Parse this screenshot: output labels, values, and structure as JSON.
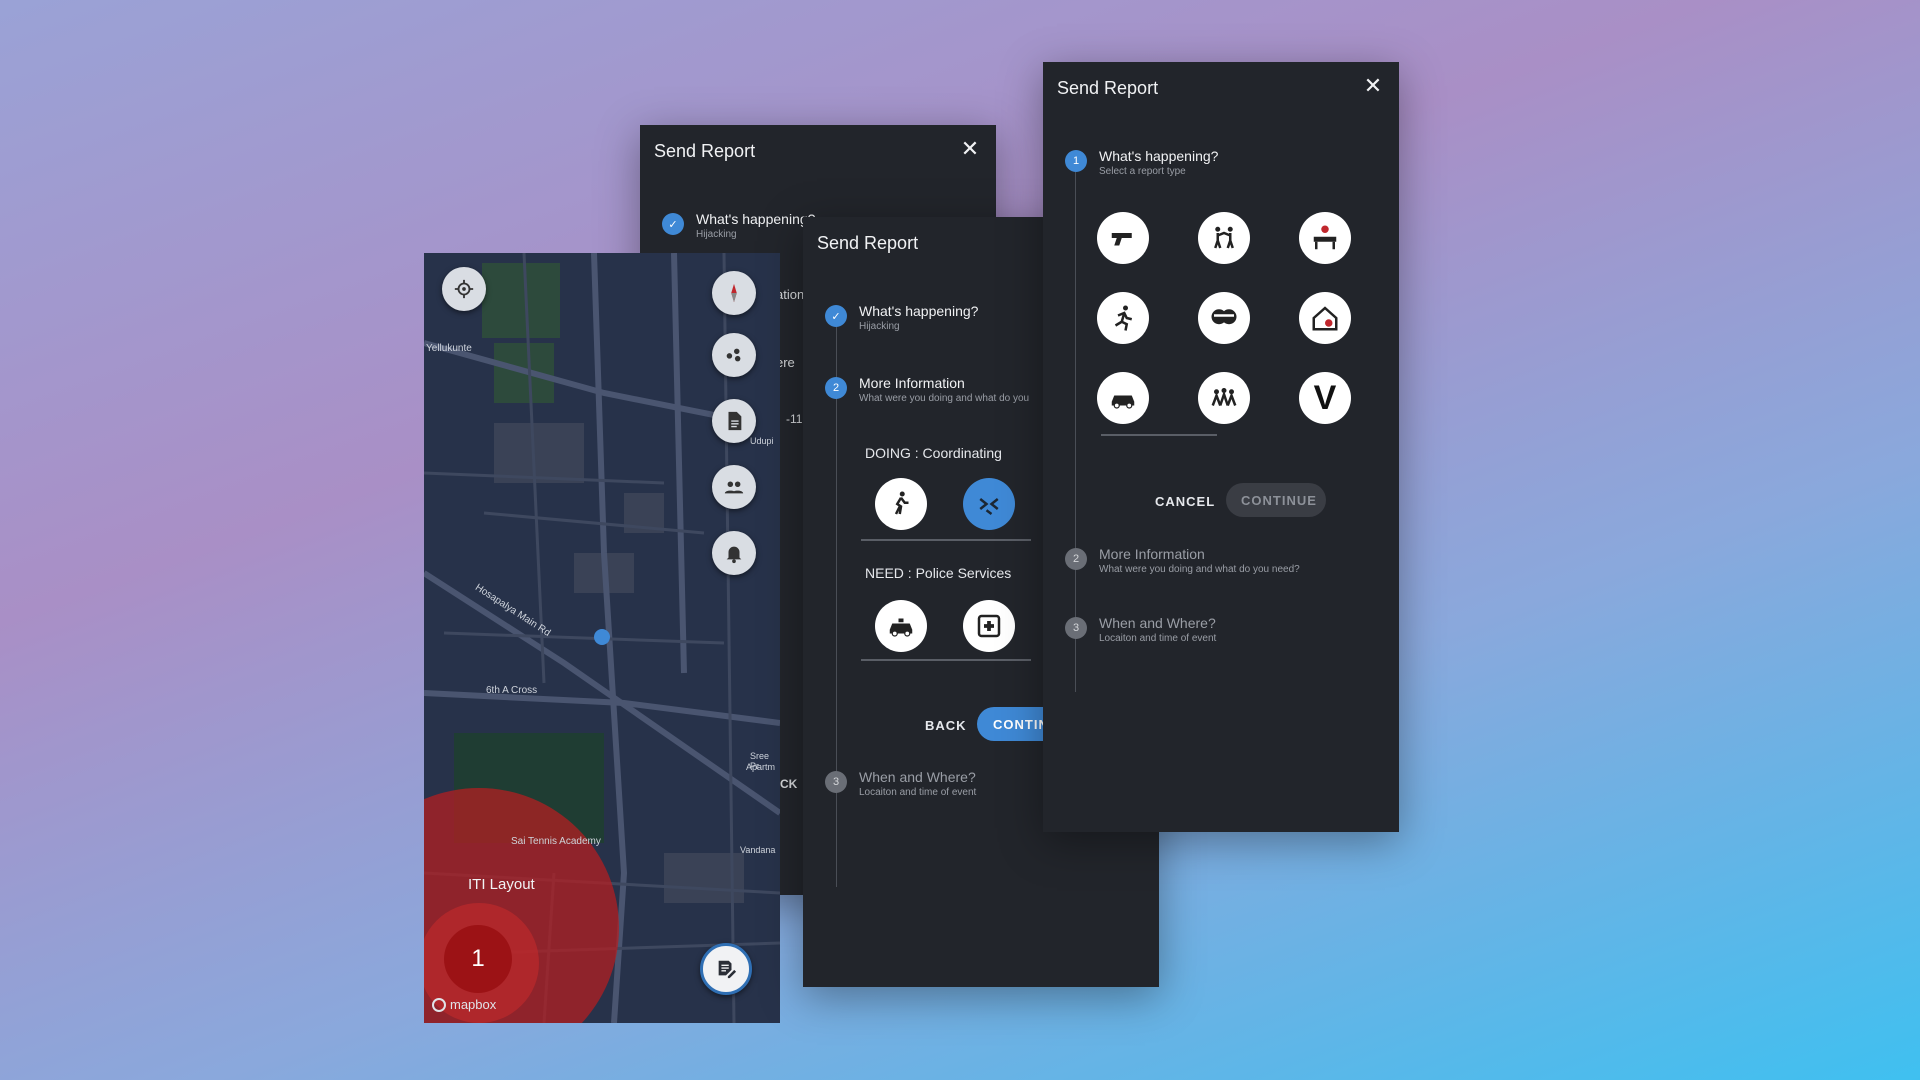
{
  "panel_a": {
    "title": "Send Report",
    "step1_title": "What's happening?",
    "step1_sub": "Hijacking",
    "partial_texts": [
      "ation",
      "ere",
      "-11",
      "CK"
    ]
  },
  "map": {
    "place_label_top": "Yellukunte",
    "road_label_1": "Hosapalya Main Rd",
    "road_label_2": "6th A Cross",
    "place_udupi": "Udupi",
    "place_sree": "Sree Pr",
    "place_apartm": "Apartm",
    "academy": "Sai Tennis Academy",
    "area_label": "ITI Layout",
    "vandana": "Vandana",
    "cluster_count": "1",
    "attribution": "mapbox",
    "colors": {
      "heat": "#b31f22",
      "user_dot": "#3f89d6"
    }
  },
  "panel_b": {
    "title": "Send Report",
    "step1_title": "What's happening?",
    "step1_sub": "Hijacking",
    "step2_num": "2",
    "step2_title": "More Information",
    "step2_sub": "What were you doing and what do you",
    "doing_label": "DOING : Coordinating",
    "need_label": "NEED : Police Services",
    "back": "BACK",
    "continue": "CONTIN",
    "step3_num": "3",
    "step3_title": "When and Where?",
    "step3_sub": "Locaiton and time of event"
  },
  "panel_c": {
    "title": "Send Report",
    "step1_num": "1",
    "step1_title": "What's happening?",
    "step1_sub": "Select a report type",
    "report_types": [
      "gun-icon",
      "fight-icon",
      "roadblock-icon",
      "running-person-icon",
      "masked-thieves-icon",
      "house-break-in-icon",
      "car-hijack-icon",
      "group-assault-icon",
      "v-icon"
    ],
    "v_label": "V",
    "cancel": "CANCEL",
    "continue": "CONTINUE",
    "step2_num": "2",
    "step2_title": "More Information",
    "step2_sub": "What were you doing and what do you need?",
    "step3_num": "3",
    "step3_title": "When and Where?",
    "step3_sub": "Locaiton and time of event"
  }
}
